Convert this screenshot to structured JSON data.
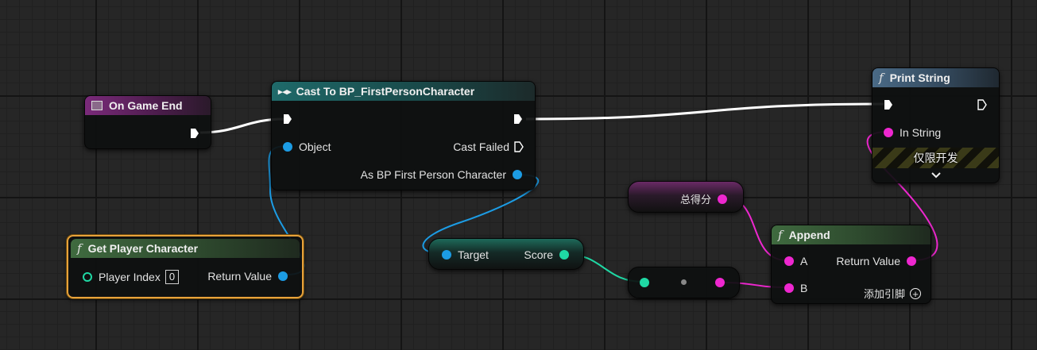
{
  "on_game_end": {
    "title": "On Game End"
  },
  "cast": {
    "title": "Cast To BP_FirstPersonCharacter",
    "object": "Object",
    "cast_failed": "Cast Failed",
    "as_character": "As BP First Person Character"
  },
  "get_player_character": {
    "title": "Get Player Character",
    "player_index_label": "Player Index",
    "player_index_value": "0",
    "return_value": "Return Value"
  },
  "score_getter": {
    "target": "Target",
    "score": "Score"
  },
  "string_literal": {
    "value": "总得分"
  },
  "append": {
    "title": "Append",
    "a": "A",
    "b": "B",
    "return_value": "Return Value",
    "add_pin": "添加引脚"
  },
  "print_string": {
    "title": "Print String",
    "in_string": "In String",
    "dev_only": "仅限开发"
  },
  "colors": {
    "exec_wire": "#ffffff",
    "object_wire": "#1c9ce4",
    "string_wire": "#ee27cf",
    "numeric_wire": "#1fd8a4",
    "selected_outline": "#e8a23a"
  }
}
